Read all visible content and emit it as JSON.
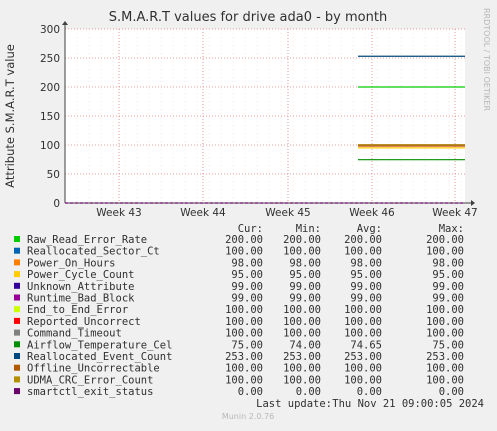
{
  "chart_data": {
    "type": "line",
    "title": "S.M.A.R.T values for drive ada0 - by month",
    "ylabel": "Attribute S.M.A.R.T value",
    "watermark": "RRDTOOL / TOBI OETIKER",
    "ylim": [
      0,
      300
    ],
    "yticks": [
      0,
      50,
      100,
      150,
      200,
      250,
      300
    ],
    "xticks": [
      "Week 43",
      "Week 44",
      "Week 45",
      "Week 46",
      "Week 47"
    ],
    "legend_headers": [
      "Cur:",
      "Min:",
      "Avg:",
      "Max:"
    ],
    "data_start": "Week 46",
    "series": [
      {
        "name": "Raw_Read_Error_Rate",
        "color": "#00cc00",
        "cur": "200.00",
        "min": "200.00",
        "avg": "200.00",
        "max": "200.00",
        "value": 200
      },
      {
        "name": "Reallocated_Sector_Ct",
        "color": "#0066b3",
        "cur": "100.00",
        "min": "100.00",
        "avg": "100.00",
        "max": "100.00",
        "value": 100
      },
      {
        "name": "Power_On_Hours",
        "color": "#ff8000",
        "cur": "98.00",
        "min": "98.00",
        "avg": "98.00",
        "max": "98.00",
        "value": 98
      },
      {
        "name": "Power_Cycle_Count",
        "color": "#ffcc00",
        "cur": "95.00",
        "min": "95.00",
        "avg": "95.00",
        "max": "95.00",
        "value": 95
      },
      {
        "name": "Unknown_Attribute",
        "color": "#330099",
        "cur": "99.00",
        "min": "99.00",
        "avg": "99.00",
        "max": "99.00",
        "value": 99
      },
      {
        "name": "Runtime_Bad_Block",
        "color": "#990099",
        "cur": "99.00",
        "min": "99.00",
        "avg": "99.00",
        "max": "99.00",
        "value": 99
      },
      {
        "name": "End_to_End_Error",
        "color": "#ccff00",
        "cur": "100.00",
        "min": "100.00",
        "avg": "100.00",
        "max": "100.00",
        "value": 100
      },
      {
        "name": "Reported_Uncorrect",
        "color": "#ff0000",
        "cur": "100.00",
        "min": "100.00",
        "avg": "100.00",
        "max": "100.00",
        "value": 100
      },
      {
        "name": "Command_Timeout",
        "color": "#808080",
        "cur": "100.00",
        "min": "100.00",
        "avg": "100.00",
        "max": "100.00",
        "value": 100
      },
      {
        "name": "Airflow_Temperature_Cel",
        "color": "#008f00",
        "cur": "75.00",
        "min": "74.00",
        "avg": "74.65",
        "max": "75.00",
        "value": 74.65
      },
      {
        "name": "Reallocated_Event_Count",
        "color": "#00487d",
        "cur": "253.00",
        "min": "253.00",
        "avg": "253.00",
        "max": "253.00",
        "value": 253
      },
      {
        "name": "Offline_Uncorrectable",
        "color": "#b35a00",
        "cur": "100.00",
        "min": "100.00",
        "avg": "100.00",
        "max": "100.00",
        "value": 100
      },
      {
        "name": "UDMA_CRC_Error_Count",
        "color": "#b38f00",
        "cur": "100.00",
        "min": "100.00",
        "avg": "100.00",
        "max": "100.00",
        "value": 100
      },
      {
        "name": "smartctl_exit_status",
        "color": "#6b006b",
        "cur": "0.00",
        "min": "0.00",
        "avg": "0.00",
        "max": "0.00",
        "value": 0
      }
    ],
    "last_update_label": "Last update:",
    "last_update_value": "Thu Nov 21 09:00:05 2024",
    "footer": "Munin 2.0.76"
  }
}
